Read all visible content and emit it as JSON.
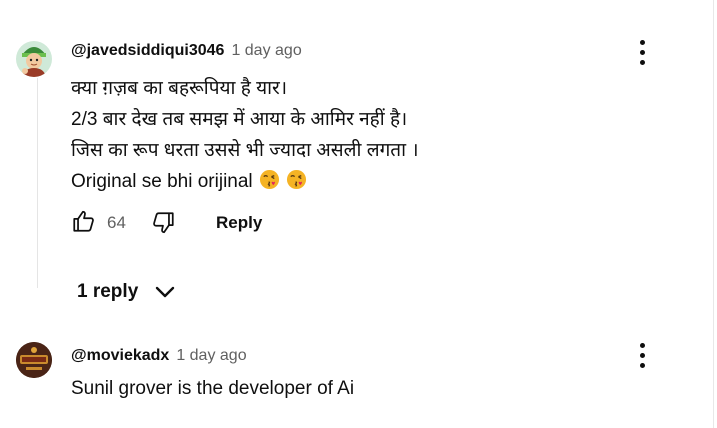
{
  "comments": [
    {
      "author": "@javedsiddiqui3046",
      "time": "1 day ago",
      "lines": [
        "क्या ग़ज़ब का बहरूपिया है यार।",
        "2/3 बार  देख तब समझ में आया के आमिर नहीं है।",
        "जिस का रूप धरता उससे भी ज्यादा असली लगता ।",
        "Original se bhi orijinal"
      ],
      "emoji": [
        "kissing-face-emoji",
        "kissing-face-emoji"
      ],
      "likes": "64",
      "reply_label": "Reply",
      "replies_label": "1 reply"
    },
    {
      "author": "@moviekadx",
      "time": "1 day ago",
      "text": "Sunil grover is the developer of Ai"
    }
  ],
  "icons": {
    "like": "thumb-up-outline-icon",
    "dislike": "thumb-down-outline-icon",
    "more": "more-vert-icon",
    "chevron": "chevron-down-icon"
  },
  "colors": {
    "text": "#0f0f0f",
    "secondary": "#606060",
    "emoji": "#f5b324"
  }
}
